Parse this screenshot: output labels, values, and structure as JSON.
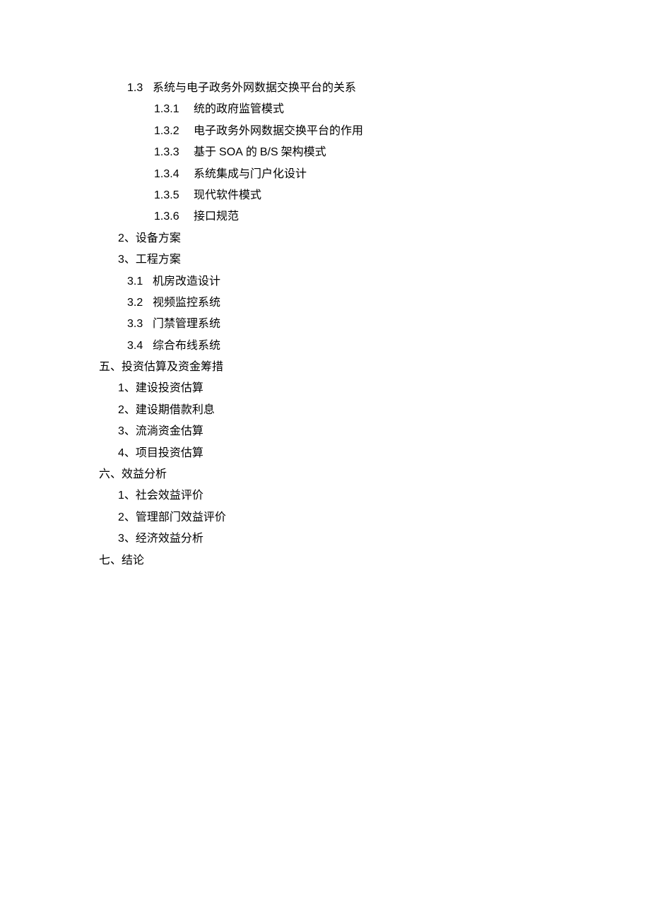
{
  "toc": {
    "s1_3": {
      "num": "1.3",
      "title": "系统与电子政务外网数据交换平台的关系",
      "items": [
        {
          "num": "1.3.1",
          "title": "统的政府监管模式"
        },
        {
          "num": "1.3.2",
          "title": "电子政务外网数据交换平台的作用"
        },
        {
          "num": "1.3.3",
          "title_pre": "基于 ",
          "title_mid": "SOA",
          "title_post": " 的 ",
          "title_mid2": "B/S",
          "title_end": " 架构模式"
        },
        {
          "num": "1.3.4",
          "title": "系统集成与门户化设计"
        },
        {
          "num": "1.3.5",
          "title": "现代软件模式"
        },
        {
          "num": "1.3.6",
          "title": "接口规范"
        }
      ]
    },
    "s2": {
      "num": "2",
      "sep": "、",
      "title": "设备方案"
    },
    "s3": {
      "num": "3",
      "sep": "、",
      "title": "工程方案",
      "items": [
        {
          "num": "3.1",
          "title": "机房改造设计"
        },
        {
          "num": "3.2",
          "title": "视频监控系统"
        },
        {
          "num": "3.3",
          "title": "门禁管理系统"
        },
        {
          "num": "3.4",
          "title": "综合布线系统"
        }
      ]
    },
    "h5": {
      "label": "五、投资估算及资金筹措",
      "items": [
        {
          "num": "1",
          "sep": "、",
          "title": "建设投资估算"
        },
        {
          "num": "2",
          "sep": "、",
          "title": "建设期借款利息"
        },
        {
          "num": "3",
          "sep": "、",
          "title": "流淌资金估算"
        },
        {
          "num": "4",
          "sep": "、",
          "title": "项目投资估算"
        }
      ]
    },
    "h6": {
      "label": "六、效益分析",
      "items": [
        {
          "num": "1",
          "sep": "、",
          "title": "社会效益评价"
        },
        {
          "num": "2",
          "sep": "、",
          "title": "管理部门效益评价"
        },
        {
          "num": "3",
          "sep": "、",
          "title": "经济效益分析"
        }
      ]
    },
    "h7": {
      "label": "七、结论"
    }
  }
}
